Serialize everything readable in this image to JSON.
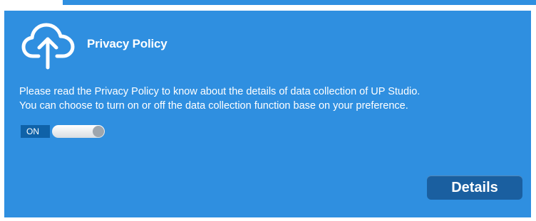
{
  "dialog": {
    "title": "Privacy Policy",
    "icon": "cloud-upload-icon",
    "description_lines": [
      "Please read the Privacy Policy to know about the details of data collection of UP Studio.",
      "You can choose to turn on or off the data collection function base on your preference."
    ],
    "toggle": {
      "state_label": "ON",
      "state": true
    },
    "details_button_label": "Details"
  },
  "colors": {
    "panel_background": "#2f8fe0",
    "button_background": "#1a5fa0",
    "toggle_label_background": "#0f62a8",
    "text": "#ffffff"
  }
}
